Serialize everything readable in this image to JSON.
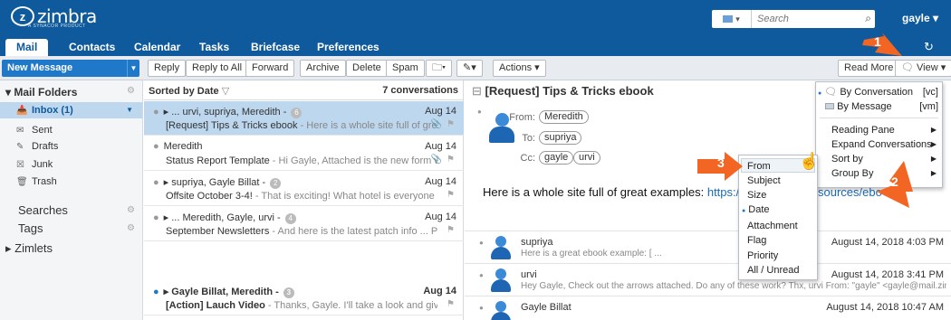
{
  "app": {
    "logo_text": "zimbra",
    "logo_sub": "A SYNACOR PRODUCT"
  },
  "search": {
    "type_label": "▾",
    "placeholder": "Search"
  },
  "user": {
    "name": "gayle ▾"
  },
  "tabs": [
    {
      "label": "Mail",
      "active": true
    },
    {
      "label": "Contacts"
    },
    {
      "label": "Calendar"
    },
    {
      "label": "Tasks"
    },
    {
      "label": "Briefcase"
    },
    {
      "label": "Preferences"
    }
  ],
  "toolbar": {
    "new_message": "New Message",
    "reply": "Reply",
    "reply_all": "Reply to All",
    "forward": "Forward",
    "archive": "Archive",
    "delete": "Delete",
    "spam": "Spam",
    "actions": "Actions ▾",
    "read_more": "Read More",
    "view": "View ▾"
  },
  "folders": {
    "heading": "▾ Mail Folders",
    "items": [
      {
        "label": "Inbox (1)",
        "icon": "inbox-icon",
        "selected": true
      },
      {
        "label": "Sent",
        "icon": "sent-icon"
      },
      {
        "label": "Drafts",
        "icon": "drafts-icon"
      },
      {
        "label": "Junk",
        "icon": "junk-icon"
      },
      {
        "label": "Trash",
        "icon": "trash-icon"
      }
    ],
    "searches": "Searches",
    "tags": "Tags",
    "zimlets": "▸ Zimlets"
  },
  "list": {
    "sort_label": "Sorted by Date",
    "count": "7 conversations",
    "rows": [
      {
        "from": "▸ ... urvi, supriya, Meredith -",
        "count": "6",
        "date": "Aug 14",
        "subject": "[Request] Tips & Tricks ebook",
        "fragment": " - Here is a whole site full of great e:",
        "selected": true,
        "clip": true
      },
      {
        "from": "Meredith",
        "date": "Aug 14",
        "subject": "Status Report Template",
        "fragment": " - Hi Gayle, Attached is the new form we w",
        "clip": true
      },
      {
        "from": "▸ supriya, Gayle Billat -",
        "count": "2",
        "date": "Aug 14",
        "subject": "Offsite October 3-4!",
        "fragment": " - That is exciting! What hotel is everyone staying i"
      },
      {
        "from": "▸ ... Meredith, Gayle, urvi -",
        "count": "4",
        "date": "Aug 14",
        "subject": "September Newsletters",
        "fragment": " - And here is the latest patch info ... Patch Info"
      },
      {
        "from": "▸ Gayle Billat, Meredith -",
        "count": "3",
        "date": "Aug 14",
        "subject": "[Action] Lauch Video",
        "fragment": " - Thanks, Gayle. I'll take a look and give you fee",
        "unread": true
      }
    ]
  },
  "reading": {
    "title": "[Request] Tips & Tricks ebook",
    "from_label": "From:",
    "to_label": "To:",
    "cc_label": "Cc:",
    "from": "Meredith",
    "to": "supriya",
    "cc": [
      "gayle",
      "urvi"
    ],
    "body_text": "Here is a whole site full of great examples: ",
    "body_link": "https://www.",
    "body_link_tail": "sources/ebo",
    "conversation": [
      {
        "from": "supriya",
        "date": "August 14, 2018 4:03 PM",
        "snippet": "Here is a great ebook example: [ ..."
      },
      {
        "from": "urvi",
        "date": "August 14, 2018 3:41 PM",
        "snippet": "Hey Gayle, Check out the arrows attached. Do any of these work? Thx, urvi From: \"gayle\" <gayle@mail.zimb"
      },
      {
        "from": "Gayle Billat",
        "date": "August 14, 2018 10:47 AM",
        "snippet": ""
      }
    ]
  },
  "view_menu": {
    "items": [
      {
        "label": "By Conversation",
        "shortcut": "[vc]",
        "selected": true
      },
      {
        "label": "By Message",
        "shortcut": "[vm]"
      },
      {
        "label": "Reading Pane",
        "submenu": true
      },
      {
        "label": "Expand Conversations",
        "submenu": true
      },
      {
        "label": "Sort by",
        "submenu": true
      },
      {
        "label": "Group By",
        "submenu": true
      }
    ]
  },
  "sort_menu": {
    "items": [
      {
        "label": "From"
      },
      {
        "label": "Subject"
      },
      {
        "label": "Size"
      },
      {
        "label": "Date",
        "selected": true
      },
      {
        "label": "Attachment"
      },
      {
        "label": "Flag"
      },
      {
        "label": "Priority"
      },
      {
        "label": "All / Unread"
      }
    ]
  },
  "callouts": [
    "1",
    "2",
    "3"
  ],
  "colors": {
    "brand": "#0f5a9c",
    "accent": "#1f78c8",
    "selected_row": "#bcd7ee",
    "arrow": "#f26522"
  }
}
